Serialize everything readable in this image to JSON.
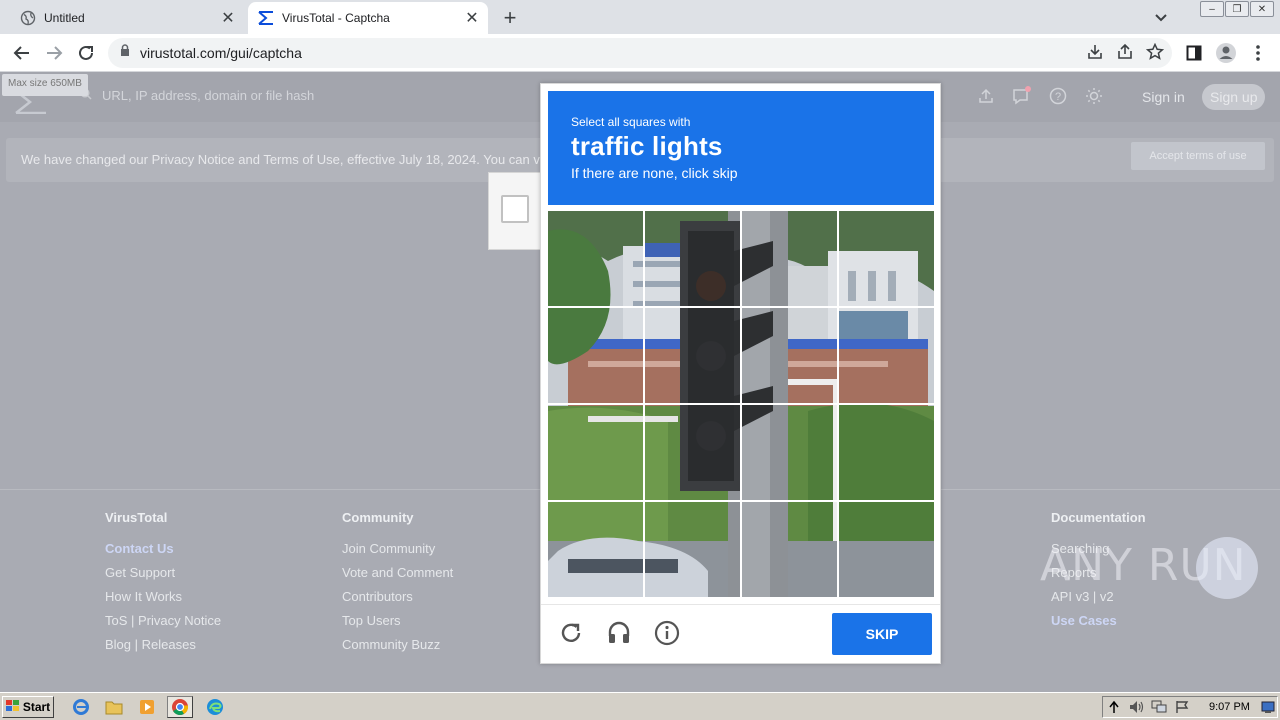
{
  "browser": {
    "tabs": [
      {
        "title": "Untitled",
        "active": false
      },
      {
        "title": "VirusTotal - Captcha",
        "active": true
      }
    ],
    "url": "virustotal.com/gui/captcha"
  },
  "vt": {
    "max_size": "Max size 650MB",
    "search_placeholder": "URL, IP address, domain or file hash",
    "sign_in": "Sign in",
    "sign_up": "Sign up",
    "notice": "We have changed our Privacy Notice and Terms of Use, effective July 18, 2024. You can v",
    "accept": "Accept terms of use"
  },
  "footer": {
    "virustotal": {
      "heading": "VirusTotal",
      "links": [
        "Contact Us",
        "Get Support",
        "How It Works",
        "ToS | Privacy Notice",
        "Blog | Releases"
      ]
    },
    "community": {
      "heading": "Community",
      "links": [
        "Join Community",
        "Vote and Comment",
        "Contributors",
        "Top Users",
        "Community Buzz"
      ]
    },
    "documentation": {
      "heading": "Documentation",
      "links": [
        "Searching",
        "Reports",
        "API v3 | v2",
        "Use Cases"
      ]
    }
  },
  "captcha": {
    "select_text": "Select all squares with",
    "object": "traffic lights",
    "hint": "If there are none, click skip",
    "skip": "SKIP",
    "colors": {
      "accent": "#1a73e8"
    }
  },
  "watermark": "ANY RUN",
  "taskbar": {
    "start": "Start",
    "clock": "9:07 PM"
  }
}
